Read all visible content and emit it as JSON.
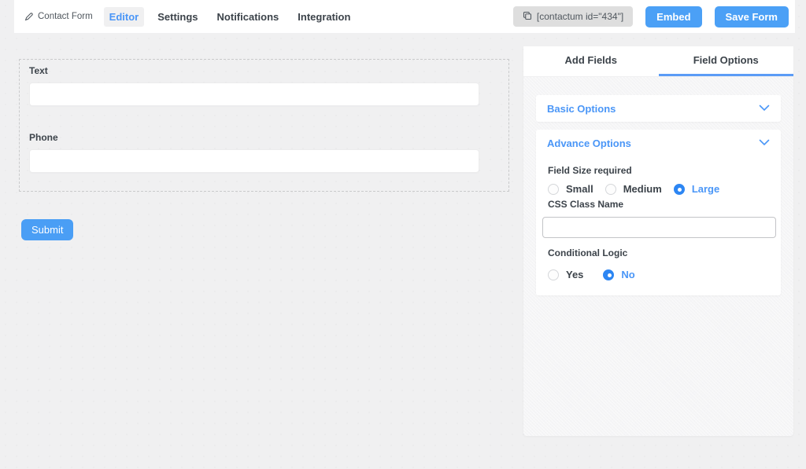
{
  "header": {
    "form_name": "Contact Form",
    "tabs": [
      {
        "label": "Editor",
        "active": true
      },
      {
        "label": "Settings",
        "active": false
      },
      {
        "label": "Notifications",
        "active": false
      },
      {
        "label": "Integration",
        "active": false
      }
    ],
    "shortcode": "[contactum id=\"434\"]",
    "embed_label": "Embed",
    "save_label": "Save Form"
  },
  "form_preview": {
    "fields": [
      {
        "label": "Text",
        "value": "",
        "placeholder": ""
      },
      {
        "label": "Phone",
        "value": "",
        "placeholder": ""
      }
    ],
    "submit_label": "Submit"
  },
  "panel": {
    "tabs": [
      {
        "label": "Add Fields",
        "active": false
      },
      {
        "label": "Field Options",
        "active": true
      }
    ],
    "sections": [
      {
        "title": "Basic Options",
        "collapsed": true
      },
      {
        "title": "Advance Options",
        "collapsed": false
      }
    ],
    "advance": {
      "field_size_label": "Field Size required",
      "field_size_options": [
        {
          "label": "Small",
          "selected": false
        },
        {
          "label": "Medium",
          "selected": false
        },
        {
          "label": "Large",
          "selected": true
        }
      ],
      "css_class_label": "CSS Class Name",
      "css_class_value": "",
      "conditional_label": "Conditional Logic",
      "conditional_options": [
        {
          "label": "Yes",
          "selected": false
        },
        {
          "label": "No",
          "selected": true
        }
      ]
    }
  },
  "icons": {
    "edit": "pencil-icon",
    "copy": "copy-icon",
    "collapse": "chevron-down-icon"
  },
  "colors": {
    "accent": "#4a96f7",
    "button_blue": "#4ba0f6",
    "radio_checked": "#2d86f3",
    "page_bg": "#f0f0f1",
    "panel_bg": "#f5f5f6"
  }
}
